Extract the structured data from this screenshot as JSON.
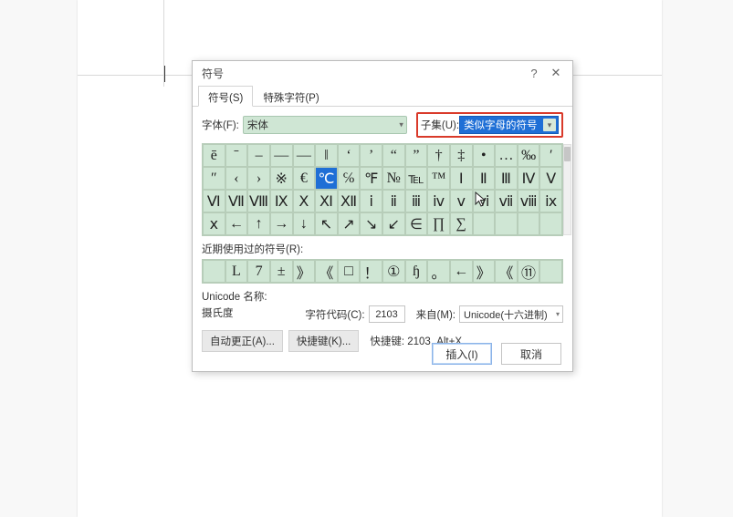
{
  "dialog": {
    "title": "符号",
    "help": "?",
    "close": "✕",
    "tabs": [
      {
        "label": "符号(S)",
        "active": true
      },
      {
        "label": "特殊字符(P)",
        "active": false
      }
    ],
    "font_label": "字体(F):",
    "font_value": "宋体",
    "subset_label": "子集(U):",
    "subset_value": "类似字母的符号",
    "grid": [
      [
        "ē",
        "ˉ",
        "–",
        "—",
        "―",
        "‖",
        "‘",
        "’",
        "“",
        "”",
        "†",
        "‡",
        "•",
        "…",
        "‰",
        "′"
      ],
      [
        "″",
        "‹",
        "›",
        "※",
        "€",
        "℃",
        "℅",
        "℉",
        "№",
        "℡",
        "™",
        "Ⅰ",
        "Ⅱ",
        "Ⅲ",
        "Ⅳ",
        "Ⅴ"
      ],
      [
        "Ⅵ",
        "Ⅶ",
        "Ⅷ",
        "Ⅸ",
        "Ⅹ",
        "Ⅺ",
        "Ⅻ",
        "ⅰ",
        "ⅱ",
        "ⅲ",
        "ⅳ",
        "ⅴ",
        "ⅵ",
        "ⅶ",
        "ⅷ",
        "ⅸ"
      ],
      [
        "ⅹ",
        "←",
        "↑",
        "→",
        "↓",
        "↖",
        "↗",
        "↘",
        "↙",
        "∈",
        "∏",
        "∑",
        "",
        "",
        "",
        ""
      ]
    ],
    "selected": {
      "row": 1,
      "col": 5
    },
    "recent_label": "近期使用过的符号(R):",
    "recent": [
      "　",
      "L",
      "7",
      "±",
      "》",
      "《",
      "□",
      "！",
      "①",
      "ɧ",
      "。",
      "←",
      "》",
      "《",
      "⑪",
      ""
    ],
    "unicode_name_label": "Unicode 名称:",
    "unicode_name": "摄氏度",
    "char_code_label": "字符代码(C):",
    "char_code": "2103",
    "from_label": "来自(M):",
    "from_value": "Unicode(十六进制)",
    "autocorrect_btn": "自动更正(A)...",
    "shortcutkey_btn": "快捷键(K)...",
    "shortcut_text": "快捷键: 2103, Alt+X",
    "insert_btn": "插入(I)",
    "cancel_btn": "取消"
  }
}
